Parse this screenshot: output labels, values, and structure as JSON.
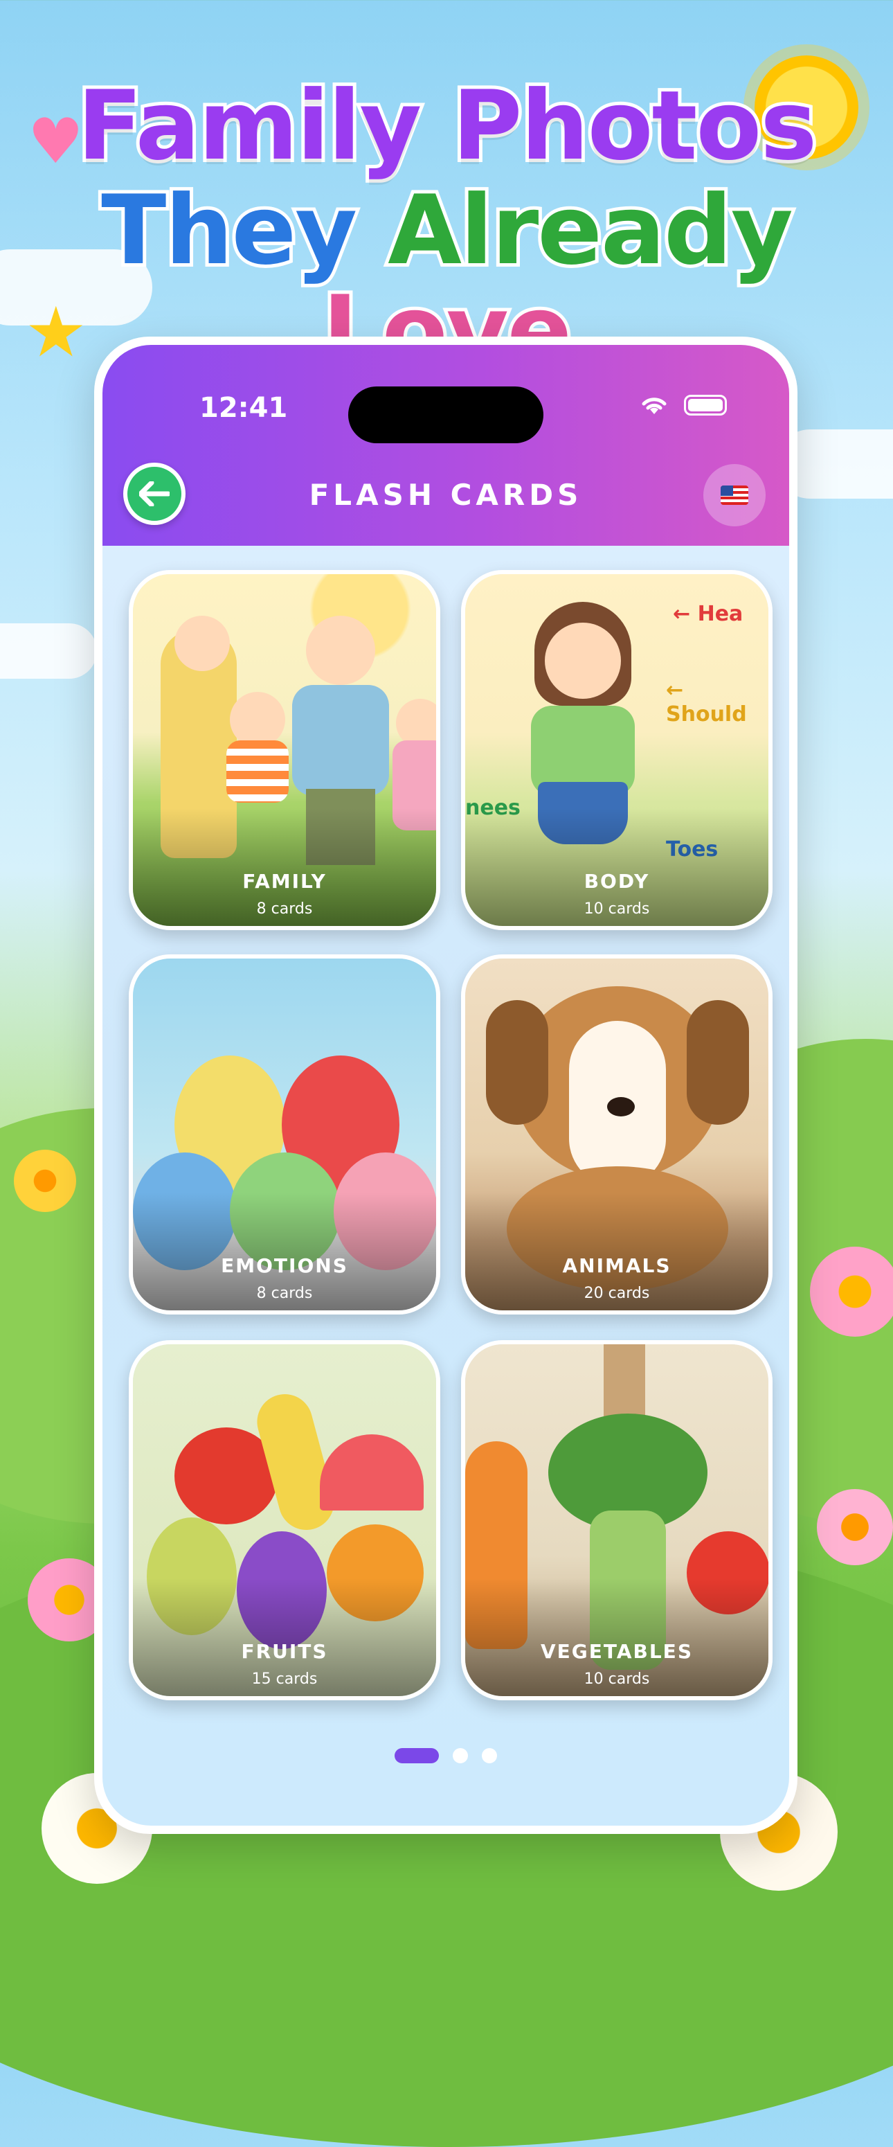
{
  "headline": {
    "line1": "Family Photos",
    "line2_word1": "They",
    "line2_word2": "Already",
    "line2_word3": "Love"
  },
  "status_bar": {
    "time": "12:41"
  },
  "nav": {
    "title": "FLASH CARDS",
    "back_icon": "back-arrow-icon",
    "language_icon": "us-flag-icon"
  },
  "cards": [
    {
      "title": "FAMILY",
      "count": "8 cards"
    },
    {
      "title": "BODY",
      "count": "10 cards"
    },
    {
      "title": "EMOTIONS",
      "count": "8 cards"
    },
    {
      "title": "ANIMALS",
      "count": "20 cards"
    },
    {
      "title": "FRUITS",
      "count": "15 cards"
    },
    {
      "title": "VEGETABLES",
      "count": "10 cards"
    }
  ],
  "pagination": {
    "pages": 3,
    "active": 1
  },
  "colors": {
    "accent_purple": "#9a3cf0",
    "blue": "#2a79e0",
    "green": "#2fa83a",
    "pink": "#e5539a",
    "back_button": "#2dbf6b"
  }
}
